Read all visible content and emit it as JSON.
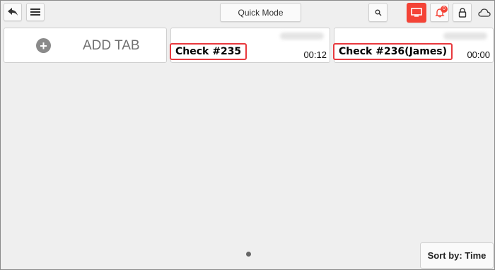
{
  "toolbar": {
    "quick_mode_label": "Quick Mode",
    "notification_count": "0",
    "accent_color": "#f44336"
  },
  "tabs": {
    "add_tab_label": "ADD TAB",
    "items": [
      {
        "name": "Check #235",
        "timer": "00:12"
      },
      {
        "name": "Check #236(James)",
        "timer": "00:00"
      }
    ]
  },
  "footer": {
    "sort_label": "Sort by: Time"
  }
}
